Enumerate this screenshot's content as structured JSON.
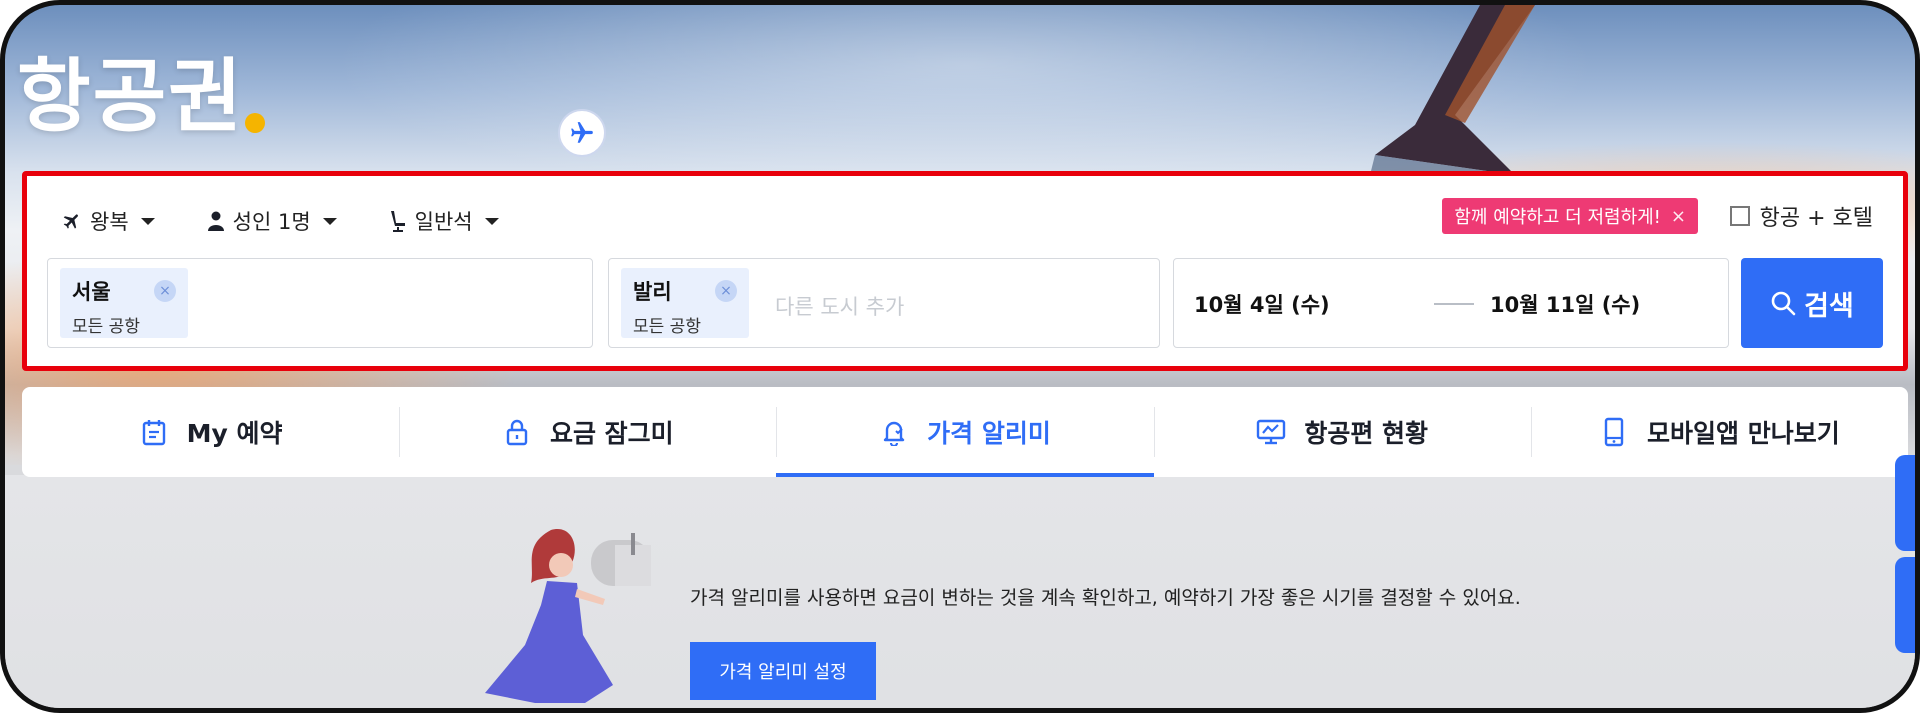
{
  "page": {
    "title": "항공권"
  },
  "search_options": {
    "trip_type": "왕복",
    "passengers": "성인 1명",
    "cabin_class": "일반석",
    "promo_text": "함께 예약하고 더 저렴하게!",
    "promo_close": "×",
    "hotel_label": "항공 + 호텔"
  },
  "origin": {
    "city": "서울",
    "airport": "모든 공항",
    "clear": "×"
  },
  "destination": {
    "city": "발리",
    "airport": "모든 공항",
    "clear": "×",
    "placeholder": "다른 도시 추가"
  },
  "dates": {
    "depart": "10월 4일 (수)",
    "return": "10월 11일 (수)"
  },
  "search_button": "검색",
  "tabs": [
    {
      "label": "My 예약",
      "icon": "calendar-icon",
      "active": false
    },
    {
      "label": "요금 잠그미",
      "icon": "lock-icon",
      "active": false
    },
    {
      "label": "가격 알리미",
      "icon": "bell-icon",
      "active": true
    },
    {
      "label": "항공편 현황",
      "icon": "monitor-icon",
      "active": false
    },
    {
      "label": "모바일앱 만나보기",
      "icon": "mobile-icon",
      "active": false
    }
  ],
  "price_alert": {
    "description": "가격 알리미를 사용하면 요금이 변하는 것을 계속 확인하고, 예약하기 가장 좋은 시기를 결정할 수 있어요.",
    "button": "가격 알리미 설정"
  },
  "colors": {
    "accent": "#2f6df6",
    "promo": "#ee3a74",
    "highlight_border": "#e8000b",
    "title_dot": "#f5b400"
  }
}
